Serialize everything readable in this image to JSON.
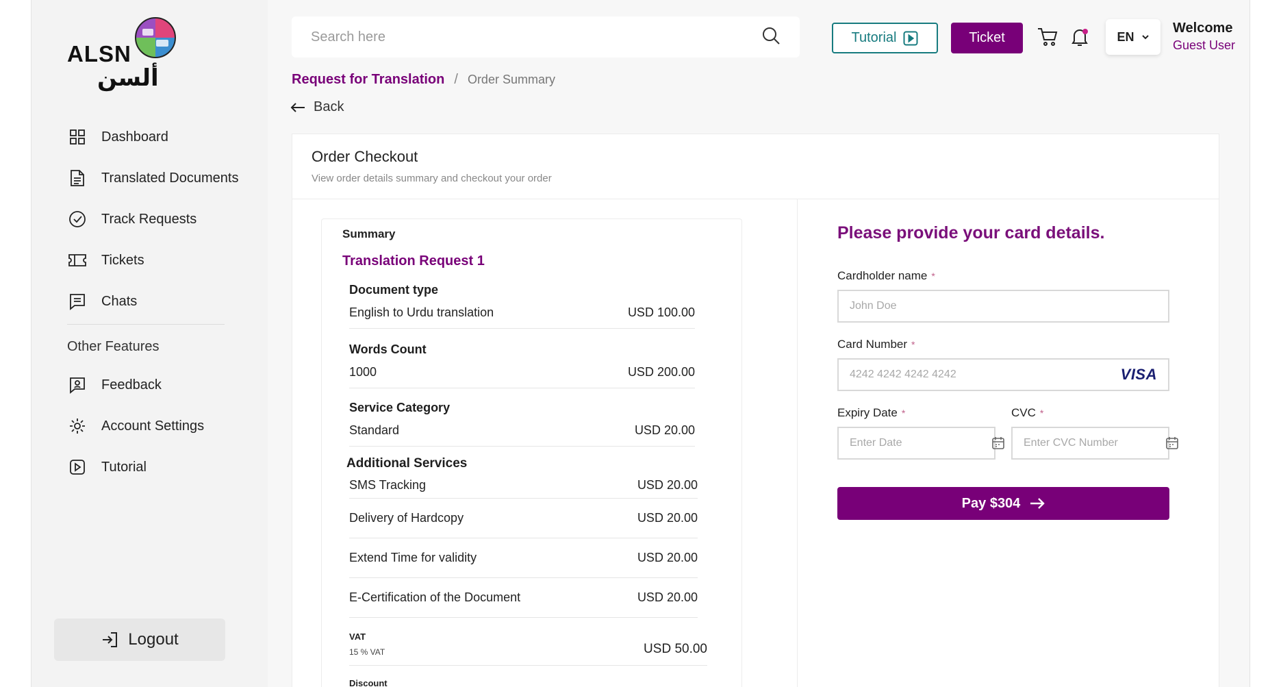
{
  "brand": {
    "logo_text": "ALSN",
    "logo_arabic": "ألسن"
  },
  "sidebar": {
    "items": [
      {
        "label": "Dashboard",
        "icon": "dashboard-grid-icon"
      },
      {
        "label": "Translated Documents",
        "icon": "document-icon"
      },
      {
        "label": "Track Requests",
        "icon": "check-circle-icon"
      },
      {
        "label": "Tickets",
        "icon": "ticket-icon"
      },
      {
        "label": "Chats",
        "icon": "chat-icon"
      }
    ],
    "section_title": "Other Features",
    "other_items": [
      {
        "label": "Feedback",
        "icon": "feedback-icon"
      },
      {
        "label": "Account Settings",
        "icon": "gear-icon"
      },
      {
        "label": "Tutorial",
        "icon": "play-icon"
      }
    ],
    "logout_label": "Logout"
  },
  "topbar": {
    "search_placeholder": "Search here",
    "tutorial_label": "Tutorial",
    "ticket_label": "Ticket",
    "language": "EN",
    "welcome": "Welcome",
    "user": "Guest User"
  },
  "breadcrumb": {
    "parent": "Request for Translation",
    "separator": "/",
    "current": "Order Summary"
  },
  "back_label": "Back",
  "checkout": {
    "title": "Order Checkout",
    "subtitle": "View order details summary and checkout your order"
  },
  "summary": {
    "title": "Summary",
    "request_title": "Translation Request 1",
    "rows": [
      {
        "label": "Document type",
        "item": "English to Urdu translation",
        "price": "USD 100.00"
      },
      {
        "label": "Words Count",
        "item": "1000",
        "price": "USD 200.00"
      },
      {
        "label": "Service Category",
        "item": "Standard",
        "price": "USD 20.00"
      }
    ],
    "additional_title": "Additional Services",
    "services": [
      {
        "item": "SMS Tracking",
        "price": "USD 20.00"
      },
      {
        "item": "Delivery of Hardcopy",
        "price": "USD 20.00"
      },
      {
        "item": "Extend Time for validity",
        "price": "USD 20.00"
      },
      {
        "item": "E-Certification of the Document",
        "price": "USD 20.00"
      }
    ],
    "vat": {
      "label": "VAT",
      "sub": "15 % VAT",
      "price": "USD 50.00"
    },
    "discount_label": "Discount"
  },
  "payment": {
    "title": "Please provide your card details.",
    "cardholder_label": "Cardholder name",
    "cardholder_placeholder": "John Doe",
    "card_number_label": "Card Number",
    "card_number_placeholder": "4242 4242 4242 4242",
    "card_brand": "VISA",
    "expiry_label": "Expiry Date",
    "expiry_placeholder": "Enter Date",
    "cvc_label": "CVC",
    "cvc_placeholder": "Enter CVC Number",
    "required_mark": "*",
    "pay_label": "Pay $304"
  },
  "colors": {
    "brand": "#780078",
    "teal": "#177b7f",
    "visa": "#1a1f71"
  }
}
